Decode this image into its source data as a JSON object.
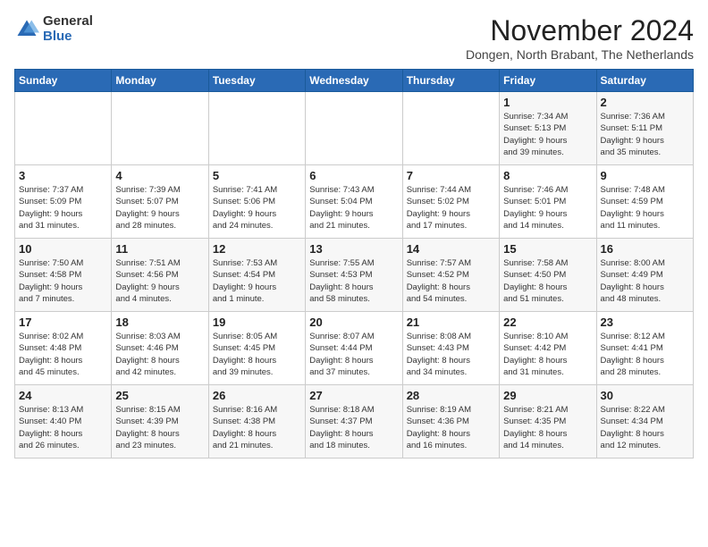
{
  "logo": {
    "general": "General",
    "blue": "Blue"
  },
  "header": {
    "title": "November 2024",
    "subtitle": "Dongen, North Brabant, The Netherlands"
  },
  "days_of_week": [
    "Sunday",
    "Monday",
    "Tuesday",
    "Wednesday",
    "Thursday",
    "Friday",
    "Saturday"
  ],
  "weeks": [
    [
      {
        "day": "",
        "info": ""
      },
      {
        "day": "",
        "info": ""
      },
      {
        "day": "",
        "info": ""
      },
      {
        "day": "",
        "info": ""
      },
      {
        "day": "",
        "info": ""
      },
      {
        "day": "1",
        "info": "Sunrise: 7:34 AM\nSunset: 5:13 PM\nDaylight: 9 hours\nand 39 minutes."
      },
      {
        "day": "2",
        "info": "Sunrise: 7:36 AM\nSunset: 5:11 PM\nDaylight: 9 hours\nand 35 minutes."
      }
    ],
    [
      {
        "day": "3",
        "info": "Sunrise: 7:37 AM\nSunset: 5:09 PM\nDaylight: 9 hours\nand 31 minutes."
      },
      {
        "day": "4",
        "info": "Sunrise: 7:39 AM\nSunset: 5:07 PM\nDaylight: 9 hours\nand 28 minutes."
      },
      {
        "day": "5",
        "info": "Sunrise: 7:41 AM\nSunset: 5:06 PM\nDaylight: 9 hours\nand 24 minutes."
      },
      {
        "day": "6",
        "info": "Sunrise: 7:43 AM\nSunset: 5:04 PM\nDaylight: 9 hours\nand 21 minutes."
      },
      {
        "day": "7",
        "info": "Sunrise: 7:44 AM\nSunset: 5:02 PM\nDaylight: 9 hours\nand 17 minutes."
      },
      {
        "day": "8",
        "info": "Sunrise: 7:46 AM\nSunset: 5:01 PM\nDaylight: 9 hours\nand 14 minutes."
      },
      {
        "day": "9",
        "info": "Sunrise: 7:48 AM\nSunset: 4:59 PM\nDaylight: 9 hours\nand 11 minutes."
      }
    ],
    [
      {
        "day": "10",
        "info": "Sunrise: 7:50 AM\nSunset: 4:58 PM\nDaylight: 9 hours\nand 7 minutes."
      },
      {
        "day": "11",
        "info": "Sunrise: 7:51 AM\nSunset: 4:56 PM\nDaylight: 9 hours\nand 4 minutes."
      },
      {
        "day": "12",
        "info": "Sunrise: 7:53 AM\nSunset: 4:54 PM\nDaylight: 9 hours\nand 1 minute."
      },
      {
        "day": "13",
        "info": "Sunrise: 7:55 AM\nSunset: 4:53 PM\nDaylight: 8 hours\nand 58 minutes."
      },
      {
        "day": "14",
        "info": "Sunrise: 7:57 AM\nSunset: 4:52 PM\nDaylight: 8 hours\nand 54 minutes."
      },
      {
        "day": "15",
        "info": "Sunrise: 7:58 AM\nSunset: 4:50 PM\nDaylight: 8 hours\nand 51 minutes."
      },
      {
        "day": "16",
        "info": "Sunrise: 8:00 AM\nSunset: 4:49 PM\nDaylight: 8 hours\nand 48 minutes."
      }
    ],
    [
      {
        "day": "17",
        "info": "Sunrise: 8:02 AM\nSunset: 4:48 PM\nDaylight: 8 hours\nand 45 minutes."
      },
      {
        "day": "18",
        "info": "Sunrise: 8:03 AM\nSunset: 4:46 PM\nDaylight: 8 hours\nand 42 minutes."
      },
      {
        "day": "19",
        "info": "Sunrise: 8:05 AM\nSunset: 4:45 PM\nDaylight: 8 hours\nand 39 minutes."
      },
      {
        "day": "20",
        "info": "Sunrise: 8:07 AM\nSunset: 4:44 PM\nDaylight: 8 hours\nand 37 minutes."
      },
      {
        "day": "21",
        "info": "Sunrise: 8:08 AM\nSunset: 4:43 PM\nDaylight: 8 hours\nand 34 minutes."
      },
      {
        "day": "22",
        "info": "Sunrise: 8:10 AM\nSunset: 4:42 PM\nDaylight: 8 hours\nand 31 minutes."
      },
      {
        "day": "23",
        "info": "Sunrise: 8:12 AM\nSunset: 4:41 PM\nDaylight: 8 hours\nand 28 minutes."
      }
    ],
    [
      {
        "day": "24",
        "info": "Sunrise: 8:13 AM\nSunset: 4:40 PM\nDaylight: 8 hours\nand 26 minutes."
      },
      {
        "day": "25",
        "info": "Sunrise: 8:15 AM\nSunset: 4:39 PM\nDaylight: 8 hours\nand 23 minutes."
      },
      {
        "day": "26",
        "info": "Sunrise: 8:16 AM\nSunset: 4:38 PM\nDaylight: 8 hours\nand 21 minutes."
      },
      {
        "day": "27",
        "info": "Sunrise: 8:18 AM\nSunset: 4:37 PM\nDaylight: 8 hours\nand 18 minutes."
      },
      {
        "day": "28",
        "info": "Sunrise: 8:19 AM\nSunset: 4:36 PM\nDaylight: 8 hours\nand 16 minutes."
      },
      {
        "day": "29",
        "info": "Sunrise: 8:21 AM\nSunset: 4:35 PM\nDaylight: 8 hours\nand 14 minutes."
      },
      {
        "day": "30",
        "info": "Sunrise: 8:22 AM\nSunset: 4:34 PM\nDaylight: 8 hours\nand 12 minutes."
      }
    ]
  ]
}
